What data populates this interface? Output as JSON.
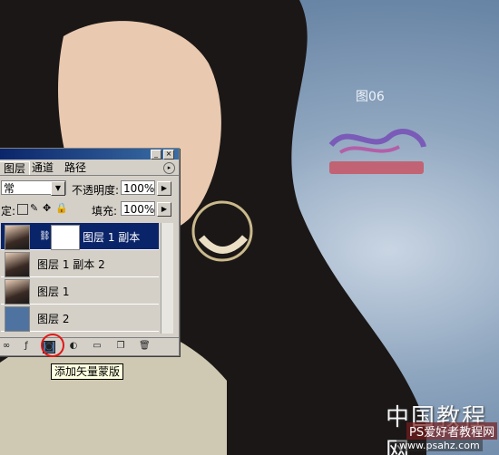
{
  "figure_label": "图06",
  "watermark": {
    "line1": "中国教程网",
    "line2": "PS爱好者教程网",
    "line3": "www.psahz.com"
  },
  "panel": {
    "tabs": [
      "图层",
      "通道",
      "路径"
    ],
    "blend_mode": "常",
    "opacity_label": "不透明度:",
    "opacity_value": "100%",
    "lock_label": "定:",
    "fill_label": "填充:",
    "fill_value": "100%",
    "layers": [
      {
        "name": "图层 1 副本",
        "selected": true,
        "has_mask": true
      },
      {
        "name": "图层 1 副本 2",
        "selected": false,
        "has_mask": false
      },
      {
        "name": "图层 1",
        "selected": false,
        "has_mask": false
      },
      {
        "name": "图层 2",
        "selected": false,
        "has_mask": false
      }
    ]
  },
  "tooltip": "添加矢量蒙版",
  "colors": {
    "selection": "#0a246a",
    "highlight_circle": "#e01818",
    "panel_bg": "#d4d0c8"
  }
}
